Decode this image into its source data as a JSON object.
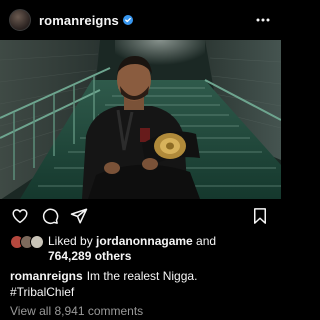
{
  "post": {
    "username": "romanreigns",
    "verified": true
  },
  "icons": {
    "more": "more-dots-icon",
    "like": "heart-icon",
    "comment": "comment-bubble-icon",
    "share": "paper-plane-icon",
    "save": "bookmark-icon",
    "verified": "verified-badge-icon"
  },
  "likes": {
    "prefix": "Liked by ",
    "liked_by": "jordanonnagame",
    "and": " and",
    "others": "764,289 others"
  },
  "caption": {
    "username": "romanreigns",
    "text": "Im the realest Nigga.",
    "hashtag": "#TribalChief"
  },
  "comments": {
    "link": "View all 8,941 comments"
  },
  "colors": {
    "background": "#000000",
    "text": "#f5f5f5",
    "muted": "#9a9a9a",
    "verified": "#3897f0"
  }
}
